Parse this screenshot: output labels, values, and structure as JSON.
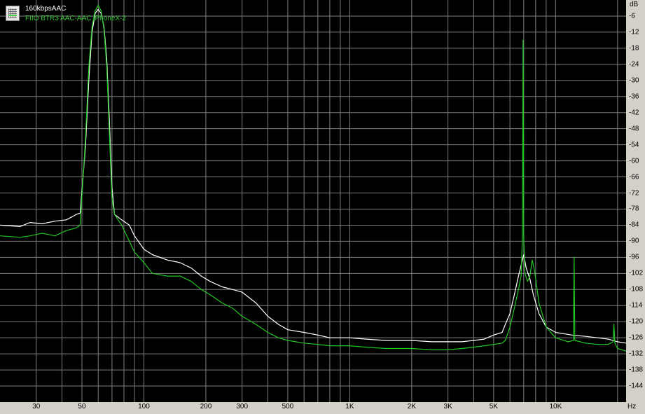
{
  "legend": {
    "entries": [
      "160kbpsAAC",
      "FIIO BTR3 AAC-AAC iPhoneX-2"
    ]
  },
  "colors": {
    "background": "#000000",
    "grid": "#7f7f7f",
    "series_white": "#ffffff",
    "series_green": "#22c822",
    "frame": "#d4d0c8"
  },
  "chart_data": {
    "type": "line",
    "x_scale": "log",
    "xlim": [
      20,
      22000
    ],
    "ylim": [
      -150,
      0
    ],
    "x_unit": "Hz",
    "y_unit": "dB",
    "grid": true,
    "legend_position": "top-left",
    "x_ticks": [
      {
        "v": 30,
        "label": "30"
      },
      {
        "v": 50,
        "label": "50"
      },
      {
        "v": 100,
        "label": "100"
      },
      {
        "v": 200,
        "label": "200"
      },
      {
        "v": 300,
        "label": "300"
      },
      {
        "v": 500,
        "label": "500"
      },
      {
        "v": 1000,
        "label": "1K"
      },
      {
        "v": 2000,
        "label": "2K"
      },
      {
        "v": 3000,
        "label": "3K"
      },
      {
        "v": 5000,
        "label": "5K"
      },
      {
        "v": 10000,
        "label": "10K"
      }
    ],
    "x_gridlines": [
      30,
      40,
      50,
      60,
      70,
      80,
      90,
      100,
      200,
      300,
      400,
      500,
      600,
      700,
      800,
      900,
      1000,
      2000,
      3000,
      4000,
      5000,
      6000,
      7000,
      8000,
      9000,
      10000,
      20000
    ],
    "y_ticks": [
      -6,
      -12,
      -18,
      -24,
      -30,
      -36,
      -42,
      -48,
      -54,
      -60,
      -66,
      -72,
      -78,
      -84,
      -90,
      -96,
      -102,
      -108,
      -114,
      -120,
      -126,
      -132,
      -138,
      -144
    ],
    "series": [
      {
        "name": "160kbpsAAC",
        "color": "#ffffff",
        "points": [
          [
            20,
            -84
          ],
          [
            25,
            -84.5
          ],
          [
            28,
            -83
          ],
          [
            32,
            -83.5
          ],
          [
            37,
            -82.5
          ],
          [
            42,
            -82
          ],
          [
            47,
            -80
          ],
          [
            49,
            -79.5
          ],
          [
            52,
            -55
          ],
          [
            54,
            -30
          ],
          [
            56,
            -12
          ],
          [
            58,
            -5
          ],
          [
            60,
            -3.5
          ],
          [
            62,
            -5
          ],
          [
            64,
            -10
          ],
          [
            66,
            -22
          ],
          [
            68,
            -45
          ],
          [
            70,
            -70
          ],
          [
            72,
            -80
          ],
          [
            78,
            -82
          ],
          [
            85,
            -84
          ],
          [
            90,
            -88
          ],
          [
            100,
            -93
          ],
          [
            110,
            -95
          ],
          [
            130,
            -97
          ],
          [
            150,
            -98
          ],
          [
            170,
            -100
          ],
          [
            190,
            -103
          ],
          [
            210,
            -105
          ],
          [
            240,
            -107
          ],
          [
            270,
            -108
          ],
          [
            300,
            -109
          ],
          [
            350,
            -113
          ],
          [
            400,
            -118
          ],
          [
            450,
            -121
          ],
          [
            500,
            -123
          ],
          [
            600,
            -124
          ],
          [
            700,
            -125
          ],
          [
            800,
            -126
          ],
          [
            1000,
            -126
          ],
          [
            1200,
            -126.5
          ],
          [
            1500,
            -127
          ],
          [
            2000,
            -127
          ],
          [
            2500,
            -127.5
          ],
          [
            3000,
            -127.5
          ],
          [
            3500,
            -127.5
          ],
          [
            4000,
            -127
          ],
          [
            4500,
            -126.5
          ],
          [
            5000,
            -125
          ],
          [
            5500,
            -124
          ],
          [
            5700,
            -121
          ],
          [
            6000,
            -117
          ],
          [
            6300,
            -110
          ],
          [
            6600,
            -103
          ],
          [
            6900,
            -97
          ],
          [
            7000,
            -95
          ],
          [
            7200,
            -100
          ],
          [
            7500,
            -104
          ],
          [
            7800,
            -110
          ],
          [
            8300,
            -117
          ],
          [
            9000,
            -122
          ],
          [
            10000,
            -124
          ],
          [
            12000,
            -125
          ],
          [
            14000,
            -125.5
          ],
          [
            16000,
            -126
          ],
          [
            18000,
            -126.5
          ],
          [
            20000,
            -127.5
          ],
          [
            22000,
            -128
          ]
        ]
      },
      {
        "name": "FIIO BTR3 AAC-AAC iPhoneX-2",
        "color": "#22c822",
        "points": [
          [
            20,
            -88
          ],
          [
            25,
            -88.5
          ],
          [
            28,
            -88
          ],
          [
            32,
            -87
          ],
          [
            37,
            -88
          ],
          [
            42,
            -86
          ],
          [
            47,
            -85
          ],
          [
            49,
            -84
          ],
          [
            52,
            -52
          ],
          [
            54,
            -25
          ],
          [
            56,
            -10
          ],
          [
            58,
            -4
          ],
          [
            60,
            -2
          ],
          [
            62,
            -4
          ],
          [
            64,
            -11
          ],
          [
            66,
            -25
          ],
          [
            68,
            -50
          ],
          [
            70,
            -74
          ],
          [
            72,
            -80
          ],
          [
            78,
            -84
          ],
          [
            85,
            -90
          ],
          [
            90,
            -94
          ],
          [
            100,
            -98
          ],
          [
            110,
            -102
          ],
          [
            130,
            -103
          ],
          [
            150,
            -103
          ],
          [
            170,
            -105
          ],
          [
            190,
            -108
          ],
          [
            210,
            -110
          ],
          [
            240,
            -113
          ],
          [
            270,
            -115
          ],
          [
            300,
            -118
          ],
          [
            350,
            -121
          ],
          [
            400,
            -124
          ],
          [
            450,
            -126
          ],
          [
            500,
            -127
          ],
          [
            600,
            -128
          ],
          [
            700,
            -128.5
          ],
          [
            800,
            -129
          ],
          [
            1000,
            -129
          ],
          [
            1200,
            -129.5
          ],
          [
            1500,
            -130
          ],
          [
            2000,
            -130
          ],
          [
            2500,
            -130.5
          ],
          [
            3000,
            -130.5
          ],
          [
            3500,
            -130
          ],
          [
            4000,
            -129.5
          ],
          [
            4500,
            -129
          ],
          [
            5000,
            -128.5
          ],
          [
            5500,
            -128
          ],
          [
            5700,
            -127
          ],
          [
            6000,
            -122
          ],
          [
            6300,
            -115
          ],
          [
            6600,
            -108
          ],
          [
            6800,
            -103
          ],
          [
            6900,
            -88
          ],
          [
            6950,
            -15
          ],
          [
            7000,
            -88
          ],
          [
            7100,
            -102
          ],
          [
            7300,
            -105
          ],
          [
            7500,
            -103
          ],
          [
            7700,
            -97
          ],
          [
            7900,
            -101
          ],
          [
            8300,
            -113
          ],
          [
            9000,
            -122
          ],
          [
            10000,
            -126
          ],
          [
            11500,
            -127.5
          ],
          [
            12200,
            -127
          ],
          [
            12300,
            -96
          ],
          [
            12400,
            -127
          ],
          [
            14000,
            -128
          ],
          [
            16000,
            -128.5
          ],
          [
            18000,
            -128.5
          ],
          [
            19000,
            -127.5
          ],
          [
            19200,
            -121
          ],
          [
            19400,
            -128
          ],
          [
            20000,
            -130
          ],
          [
            22000,
            -131
          ]
        ]
      }
    ]
  }
}
